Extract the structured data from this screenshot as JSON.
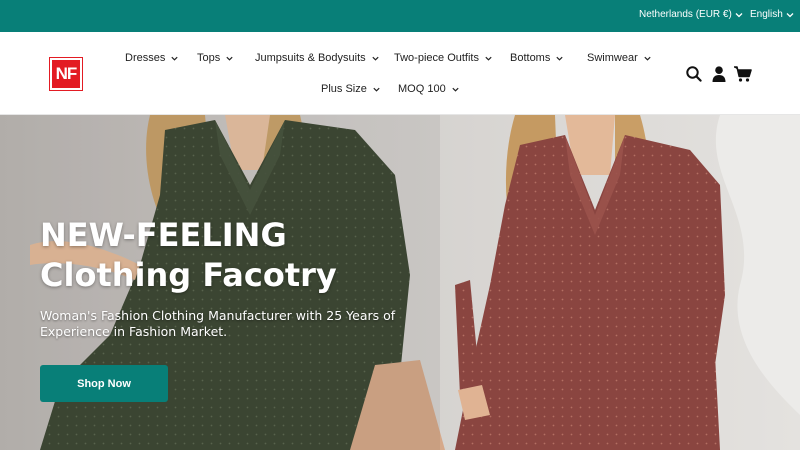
{
  "topbar": {
    "country_selector": "Netherlands (EUR €)",
    "language_selector": "English",
    "background_color": "#087f78"
  },
  "header": {
    "logo_text": "NF",
    "logo_color": "#e31b23",
    "nav": [
      {
        "label": "Dresses",
        "icon": "chevron-down-icon"
      },
      {
        "label": "Tops",
        "icon": "chevron-down-icon"
      },
      {
        "label": "Jumpsuits & Bodysuits",
        "icon": "chevron-down-icon"
      },
      {
        "label": "Two-piece Outfits",
        "icon": "chevron-down-icon"
      },
      {
        "label": "Bottoms",
        "icon": "chevron-down-icon"
      },
      {
        "label": "Swimwear",
        "icon": "chevron-down-icon"
      },
      {
        "label": "Plus Size",
        "icon": "chevron-down-icon"
      },
      {
        "label": "MOQ 100",
        "icon": "chevron-down-icon"
      }
    ],
    "icons": [
      "search-icon",
      "account-icon",
      "cart-icon"
    ]
  },
  "hero": {
    "title_line1": "NEW-FEELING",
    "title_line2": "Clothing Facotry",
    "subtitle": "Woman's Fashion Clothing Manufacturer with 25 Years of Experience in Fashion Market.",
    "cta_label": "Shop Now",
    "cta_color": "#087f78",
    "image": "two models wearing long-sleeve dotted chiffon dresses, olive green and rust red"
  }
}
